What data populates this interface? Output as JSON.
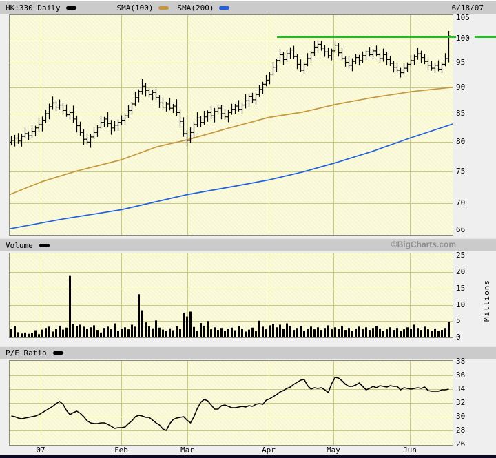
{
  "header": {
    "symbol_timeframe": "HK:330 Daily",
    "sma100": "SMA(100)",
    "sma200": "SMA(200)",
    "date": "6/18/07"
  },
  "labels": {
    "volume": "Volume",
    "pe": "P/E Ratio",
    "watermark": "©BigCharts.com",
    "millions": "Millions"
  },
  "colors": {
    "background": "#EFEFEF",
    "panel_bg": "#FBFBDC",
    "grid": "#C9C97F",
    "band_bg": "#CBCBCB",
    "price_bars": "#000000",
    "sma100": "#C8963C",
    "sma200": "#2060E0",
    "alert_green": "#1FBE1F",
    "watermark_gray": "#8E8E8E",
    "bottom_border": "#0A0A28"
  },
  "x_axis": {
    "categories": [
      "07",
      "Feb",
      "Mar",
      "Apr",
      "May",
      "Jun"
    ],
    "tick_x": [
      59,
      176,
      272,
      390,
      484,
      595
    ]
  },
  "chart_data": [
    {
      "type": "ohlc",
      "name": "price",
      "title": "HK:330 Daily",
      "y_axis": {
        "ticks": [
          105,
          100,
          95,
          90,
          85,
          80,
          75,
          70,
          66
        ],
        "scale": "log",
        "ylim": [
          65.3,
          105.5
        ]
      },
      "closes": [
        80.2,
        80.6,
        80.1,
        80.9,
        81.4,
        81.0,
        81.8,
        82.4,
        83.0,
        83.8,
        85.0,
        86.3,
        87.0,
        86.2,
        86.6,
        85.6,
        84.8,
        85.2,
        84.0,
        82.8,
        81.6,
        80.4,
        79.9,
        80.8,
        81.6,
        82.5,
        83.4,
        84.0,
        83.2,
        82.4,
        82.9,
        83.4,
        83.8,
        84.6,
        85.6,
        86.8,
        88.0,
        89.2,
        90.2,
        89.4,
        88.6,
        89.0,
        88.0,
        87.0,
        86.2,
        86.8,
        86.0,
        86.4,
        85.2,
        83.6,
        81.4,
        80.2,
        81.6,
        83.0,
        84.2,
        83.4,
        84.4,
        85.2,
        84.6,
        85.4,
        86.0,
        85.0,
        84.4,
        85.2,
        85.8,
        86.4,
        85.8,
        86.6,
        87.4,
        88.2,
        87.6,
        88.6,
        89.6,
        90.6,
        91.4,
        92.6,
        94.0,
        95.4,
        96.6,
        95.6,
        96.8,
        97.6,
        96.2,
        94.6,
        93.4,
        94.6,
        95.8,
        97.0,
        98.2,
        98.8,
        98.0,
        97.2,
        96.4,
        97.4,
        98.6,
        97.0,
        95.8,
        95.0,
        94.4,
        95.2,
        96.0,
        95.4,
        96.4,
        97.2,
        96.6,
        97.4,
        96.6,
        95.8,
        96.6,
        95.6,
        94.8,
        94.0,
        93.4,
        92.9,
        93.8,
        94.6,
        95.4,
        96.2,
        96.8,
        96.0,
        95.2,
        94.4,
        93.8,
        94.4,
        93.6,
        94.6,
        95.8,
        100.6
      ],
      "bar_ranges": {
        "up": [
          0.9,
          0.5,
          1.3,
          0.7,
          1.6,
          0.5,
          1.1,
          0.8,
          1.4,
          0.6
        ],
        "dn": [
          0.7,
          1.2,
          0.5,
          1.5,
          0.6,
          1.0,
          0.8,
          1.3,
          0.5,
          1.1
        ]
      },
      "overrides": {
        "12": {
          "high": 88.2
        },
        "38": {
          "high": 91.6
        },
        "127": {
          "high": 101.7,
          "low": 95.0
        }
      },
      "sma100": {
        "label": "SMA(100)",
        "color": "#C8963C",
        "points": [
          [
            14,
            71.3
          ],
          [
            60,
            73.3
          ],
          [
            110,
            75.0
          ],
          [
            176,
            76.9
          ],
          [
            228,
            79.1
          ],
          [
            272,
            80.3
          ],
          [
            330,
            82.3
          ],
          [
            390,
            84.3
          ],
          [
            440,
            85.3
          ],
          [
            490,
            86.8
          ],
          [
            540,
            88.0
          ],
          [
            600,
            89.2
          ],
          [
            657,
            90.0
          ]
        ]
      },
      "sma200": {
        "label": "SMA(200)",
        "color": "#2060E0",
        "points": [
          [
            14,
            66.2
          ],
          [
            90,
            67.6
          ],
          [
            176,
            69.0
          ],
          [
            272,
            71.3
          ],
          [
            340,
            72.6
          ],
          [
            390,
            73.6
          ],
          [
            440,
            74.9
          ],
          [
            490,
            76.5
          ],
          [
            540,
            78.3
          ],
          [
            595,
            80.6
          ],
          [
            657,
            83.1
          ]
        ]
      },
      "alert_line": {
        "value": 100.5,
        "color": "#1FBE1F",
        "x_start": 402
      }
    },
    {
      "type": "bar",
      "name": "volume",
      "title": "Volume",
      "unit": "Millions",
      "y_axis": {
        "ticks": [
          25,
          20,
          15,
          10,
          5,
          0
        ],
        "ylim": [
          0,
          26
        ]
      },
      "values": [
        2.6,
        3.4,
        1.6,
        1.2,
        1.5,
        1.1,
        1.4,
        2.2,
        1.0,
        2.4,
        2.9,
        3.3,
        1.8,
        2.6,
        3.6,
        2.4,
        3.0,
        18.8,
        4.1,
        3.5,
        3.9,
        3.3,
        2.7,
        3.1,
        3.7,
        2.3,
        1.5,
        2.9,
        3.3,
        2.5,
        4.3,
        2.1,
        2.7,
        3.1,
        2.5,
        3.9,
        3.3,
        13.2,
        8.3,
        4.6,
        3.4,
        2.8,
        5.2,
        3.0,
        2.4,
        2.0,
        2.8,
        2.2,
        3.4,
        2.6,
        7.6,
        6.4,
        7.9,
        3.2,
        2.1,
        4.4,
        3.6,
        5.0,
        2.5,
        3.1,
        2.3,
        2.9,
        2.1,
        2.7,
        3.0,
        2.2,
        3.4,
        2.6,
        1.8,
        2.4,
        3.0,
        2.0,
        5.1,
        3.3,
        2.5,
        3.7,
        4.1,
        3.1,
        3.9,
        2.7,
        4.3,
        3.5,
        2.3,
        2.9,
        3.5,
        2.1,
        2.7,
        3.3,
        2.5,
        3.1,
        2.3,
        2.9,
        3.7,
        2.5,
        3.1,
        2.7,
        3.5,
        2.3,
        2.9,
        2.1,
        2.7,
        3.3,
        2.5,
        3.1,
        2.3,
        2.9,
        3.5,
        2.7,
        2.1,
        2.5,
        3.1,
        2.3,
        2.9,
        1.9,
        2.5,
        3.1,
        2.7,
        3.9,
        2.9,
        2.3,
        3.3,
        2.5,
        2.1,
        2.7,
        1.9,
        2.3,
        2.9,
        4.7
      ]
    },
    {
      "type": "line",
      "name": "pe_ratio",
      "title": "P/E Ratio",
      "y_axis": {
        "ticks": [
          38,
          36,
          34,
          32,
          30,
          28,
          26
        ],
        "ylim": [
          25.9,
          38.2
        ]
      },
      "values": [
        30.1,
        30.0,
        29.8,
        29.7,
        29.8,
        29.9,
        30.0,
        30.1,
        30.3,
        30.6,
        30.9,
        31.2,
        31.5,
        31.9,
        32.2,
        31.8,
        30.9,
        30.3,
        30.6,
        30.8,
        30.5,
        30.0,
        29.4,
        29.1,
        29.0,
        29.0,
        29.1,
        29.1,
        28.9,
        28.6,
        28.3,
        28.4,
        28.4,
        28.5,
        29.0,
        29.4,
        30.0,
        30.2,
        30.1,
        29.9,
        29.9,
        29.5,
        29.1,
        28.8,
        28.2,
        28.0,
        29.0,
        29.6,
        29.8,
        29.9,
        30.0,
        29.5,
        29.1,
        30.0,
        31.2,
        32.1,
        32.5,
        32.3,
        31.7,
        31.1,
        31.1,
        31.6,
        31.7,
        31.5,
        31.3,
        31.3,
        31.4,
        31.5,
        31.4,
        31.6,
        31.5,
        31.8,
        31.9,
        31.8,
        32.4,
        32.6,
        32.9,
        33.2,
        33.6,
        33.8,
        34.1,
        34.3,
        34.7,
        35.0,
        35.3,
        35.4,
        34.5,
        34.0,
        34.2,
        34.1,
        34.2,
        33.9,
        33.5,
        34.8,
        35.7,
        35.6,
        35.2,
        34.7,
        34.4,
        34.4,
        34.6,
        34.9,
        34.4,
        33.9,
        34.1,
        34.4,
        34.2,
        34.5,
        34.4,
        34.3,
        34.5,
        34.4,
        34.4,
        33.9,
        34.2,
        34.1,
        34.0,
        34.1,
        34.2,
        34.1,
        34.3,
        33.8,
        33.7,
        33.7,
        33.7,
        33.9,
        33.9,
        34.0
      ]
    }
  ]
}
